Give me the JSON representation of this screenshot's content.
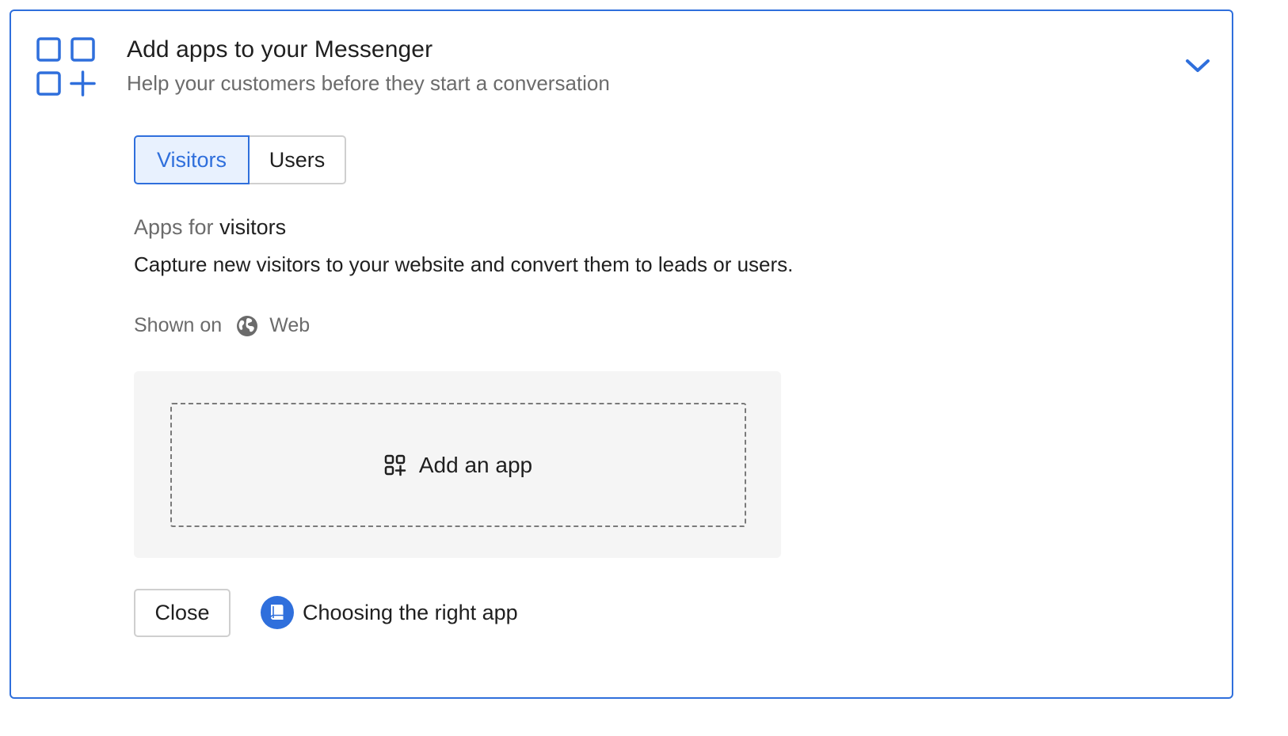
{
  "header": {
    "title": "Add apps to your Messenger",
    "subtitle": "Help your customers before they start a conversation",
    "icon": "apps-grid-add-icon",
    "collapse_icon": "chevron-down-icon"
  },
  "tabs": [
    {
      "label": "Visitors",
      "selected": true
    },
    {
      "label": "Users",
      "selected": false
    }
  ],
  "section": {
    "title_prefix": "Apps for",
    "title_audience": "visitors",
    "description": "Capture new visitors to your website and convert them to leads or users."
  },
  "shown_on": {
    "label": "Shown on",
    "platform": "Web",
    "icon": "globe-icon"
  },
  "add_app": {
    "label": "Add an app",
    "icon": "apps-add-icon"
  },
  "footer": {
    "close_label": "Close",
    "help_label": "Choosing the right app",
    "help_icon": "book-icon"
  },
  "colors": {
    "accent": "#2f6fdc",
    "selected_tab_bg": "#e8f1fe",
    "muted_text": "#6b6b6b",
    "panel_bg": "#f5f5f5"
  }
}
